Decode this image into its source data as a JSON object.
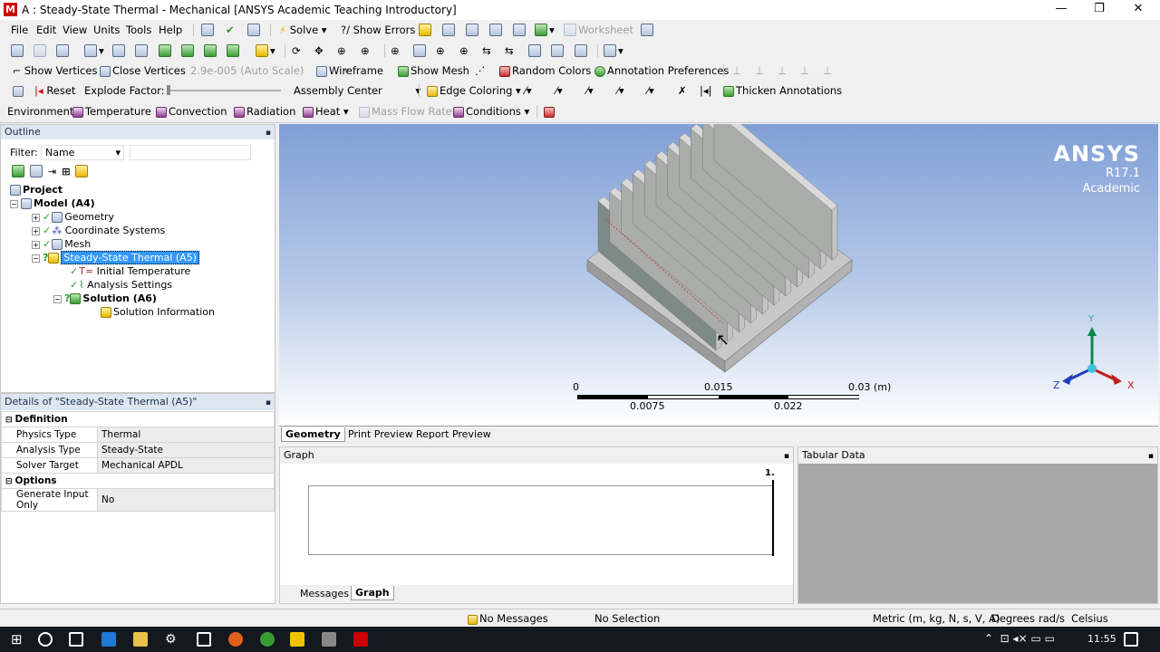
{
  "window": {
    "app_icon_letter": "M",
    "title": "A : Steady-State Thermal - Mechanical [ANSYS Academic Teaching Introductory]",
    "minimize": "—",
    "restore": "❐",
    "close": "✕"
  },
  "menu": [
    "File",
    "Edit",
    "View",
    "Units",
    "Tools",
    "Help"
  ],
  "toolbar1": {
    "solve": "Solve",
    "show_errors": "?/ Show Errors",
    "worksheet": "Worksheet"
  },
  "toolbar3": {
    "show_vertices": "Show Vertices",
    "close_vertices": "Close Vertices",
    "scale": "2.9e-005 (Auto Scale)",
    "wireframe": "Wireframe",
    "show_mesh": "Show Mesh",
    "random_colors": "Random Colors",
    "annotation_preferences": "Annotation Preferences"
  },
  "toolbar4": {
    "reset": "Reset",
    "explode_factor": "Explode Factor:",
    "assembly_center": "Assembly Center",
    "edge_coloring": "Edge Coloring",
    "thicken_annotations": "Thicken Annotations"
  },
  "toolbar5": {
    "environment": "Environment",
    "temperature": "Temperature",
    "convection": "Convection",
    "radiation": "Radiation",
    "heat": "Heat",
    "mass_flow_rate": "Mass Flow Rate",
    "conditions": "Conditions"
  },
  "outline": {
    "header": "Outline",
    "filter_label": "Filter:",
    "filter_value": "Name",
    "tree": {
      "project": "Project",
      "model": "Model (A4)",
      "geometry": "Geometry",
      "coordinate_systems": "Coordinate Systems",
      "mesh": "Mesh",
      "steady_state_thermal": "Steady-State Thermal (A5)",
      "initial_temperature": "Initial Temperature",
      "analysis_settings": "Analysis Settings",
      "solution": "Solution (A6)",
      "solution_information": "Solution Information"
    }
  },
  "details": {
    "header": "Details of \"Steady-State Thermal (A5)\"",
    "definition": "Definition",
    "rows": [
      {
        "label": "Physics Type",
        "value": "Thermal"
      },
      {
        "label": "Analysis Type",
        "value": "Steady-State"
      },
      {
        "label": "Solver Target",
        "value": "Mechanical APDL"
      }
    ],
    "options": "Options",
    "options_rows": [
      {
        "label": "Generate Input Only",
        "value": "No"
      }
    ]
  },
  "brand": {
    "name": "ANSYS",
    "version": "R17.1",
    "edition": "Academic"
  },
  "scale_bar": {
    "top_labels": [
      "0",
      "0.015",
      "0.03 (m)"
    ],
    "bottom_labels": [
      "0.0075",
      "0.022"
    ]
  },
  "triad": {
    "x": "X",
    "y": "Y",
    "z": "Z"
  },
  "view_tabs": [
    "Geometry",
    "Print Preview",
    "Report Preview"
  ],
  "graph": {
    "header": "Graph",
    "marker": "1."
  },
  "tabular": {
    "header": "Tabular Data"
  },
  "bottom_tabs": [
    "Messages",
    "Graph"
  ],
  "status": {
    "messages": "No Messages",
    "selection": "No Selection",
    "units": "Metric (m, kg, N, s, V, A)",
    "degrees": "Degrees",
    "rads": "rad/s",
    "temp": "Celsius"
  },
  "taskbar": {
    "time": "11:55"
  },
  "colors": {
    "viewport_top": "#7f9fd6",
    "viewport_bottom": "#ffffff",
    "selection": "#3399ff",
    "taskbar": "#14181f"
  }
}
